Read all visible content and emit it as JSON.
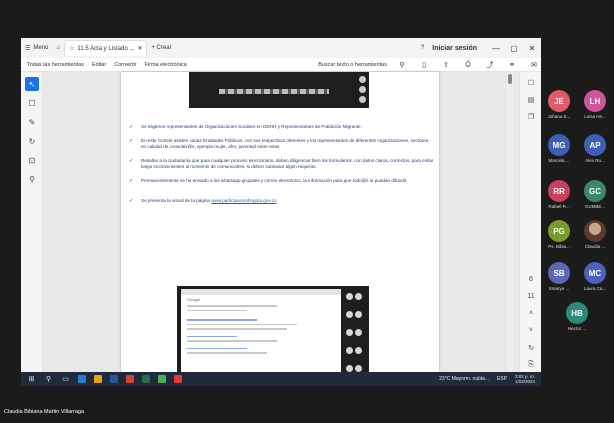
{
  "browser": {
    "tabs": [
      {
        "label": "Menú"
      },
      {
        "label": "11.5 Acta y Listado ..."
      },
      {
        "label": "+ Crear"
      }
    ],
    "login_label": "Iniciar sesión",
    "window_controls": [
      "—",
      "▢",
      "✕"
    ]
  },
  "toolbar": {
    "items": [
      "Todas las herramientas",
      "Editar",
      "Convertir",
      "Firma electrónica"
    ],
    "search_placeholder": "Buscar texto o herramientas"
  },
  "document": {
    "bullets": [
      {
        "text": "Se eligieron representantes de Organizaciones Sociales en DDHH y Representantes de Población Migrante."
      },
      {
        "text": "En este Comité asisten varias Entidades Públicas, con sus respectivos oferentes y los representantes de diferentes organizaciones, sectores, en calidad de consultiv@s, ejemplo mujer, afro, juventud entre otras."
      },
      {
        "text": "Resaltar a la ciudadanía que para cualquier proceso eleccionario, deben diligenciar bien los formularios, con datos claros, correctos, para evitar luego inconvenientes al momento de comunicarles, si deben subsanar algún requisito."
      },
      {
        "text": "Permanentemente se ha enviado a los whatsapp grupales y correo electrónico, la información para que todo@s la puedan difundir."
      },
      {
        "text": "Se presenta la visual de la página ",
        "link": "www.participacionbogota.gov.co"
      }
    ],
    "embedded_browser_text": "Google"
  },
  "right_sidebar": {
    "page_number": "6",
    "total_pages": "11"
  },
  "taskbar": {
    "weather": "23°C  Mayorm. nubla...",
    "language": "ESP",
    "time": "3:02 p. m.",
    "date": "1/02/2024"
  },
  "participants": [
    {
      "initials": "JE",
      "name": "Johana E...",
      "color": "#e05a6a"
    },
    {
      "initials": "LH",
      "name": "Luisa He...",
      "color": "#d0569b"
    },
    {
      "initials": "MG",
      "name": "Marcela ...",
      "color": "#3d5fb5"
    },
    {
      "initials": "AP",
      "name": "Alex Ro...",
      "color": "#3d5fb5"
    },
    {
      "initials": "RR",
      "name": "Rafael R...",
      "color": "#c9415f"
    },
    {
      "initials": "GC",
      "name": "GUMBE...",
      "color": "#3a8a6a"
    },
    {
      "initials": "PG",
      "name": "Ps. Bibia...",
      "color": "#7a9a2a"
    },
    {
      "initials": "",
      "name": "Claudia ...",
      "color": "#7a5a48"
    },
    {
      "initials": "SB",
      "name": "Smarye ...",
      "color": "#5b67b8"
    },
    {
      "initials": "MC",
      "name": "Laura Ca...",
      "color": "#4a63c0"
    },
    {
      "initials": "HB",
      "name": "Hector ...",
      "color": "#2d8a7a"
    }
  ],
  "speaker_name": "Claudia Bibiana Martin Villarraga"
}
